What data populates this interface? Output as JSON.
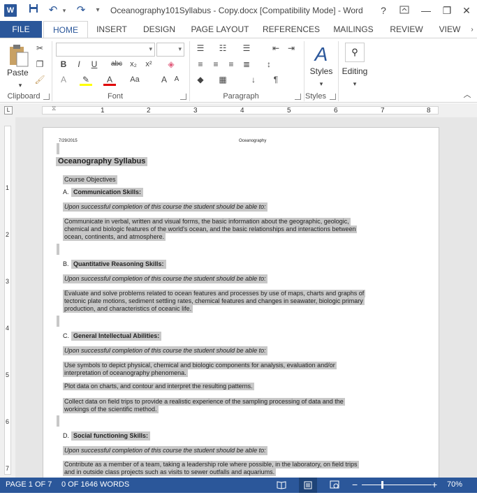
{
  "titlebar": {
    "title": "Oceanography101Syllabus - Copy.docx [Compatibility Mode] - Word",
    "app_logo": "W",
    "help": "?",
    "minimize": "—",
    "restore": "❐",
    "close": "✕"
  },
  "tabs": {
    "file": "FILE",
    "items": [
      "HOME",
      "INSERT",
      "DESIGN",
      "PAGE LAYOUT",
      "REFERENCES",
      "MAILINGS",
      "REVIEW",
      "VIEW"
    ]
  },
  "ribbon": {
    "clipboard": {
      "label": "Clipboard",
      "paste": "Paste"
    },
    "font": {
      "label": "Font",
      "name": "",
      "size": ""
    },
    "paragraph": {
      "label": "Paragraph"
    },
    "styles": {
      "label": "Styles",
      "button": "Styles"
    },
    "editing": {
      "button": "Editing"
    }
  },
  "ruler": {
    "numbers": [
      "1",
      "2",
      "3",
      "4",
      "5",
      "6",
      "7",
      "8"
    ]
  },
  "vruler": {
    "numbers": [
      "1",
      "2",
      "3",
      "4",
      "5",
      "6",
      "7"
    ]
  },
  "document": {
    "header_date": "7/29/2015",
    "header_title": "Oceanography",
    "title": "Oceanography Syllabus",
    "course_objectives": "Course Objectives",
    "sections": [
      {
        "letter": "A.",
        "heading": "Communication   Skills:",
        "intro": "Upon successful completion of this course the student should be able to:",
        "paras": [
          [
            "Communicate in verbal, written and visual forms, the basic information about the geographic, geologic,",
            "chemical and biologic features of the world's ocean, and the basic relationships and interactions between",
            "ocean, continents, and  atmosphere."
          ]
        ]
      },
      {
        "letter": "B.",
        "heading": "Quantitative  Reasoning Skills:",
        "intro": "Upon successful completion of this course the student should be able to:",
        "paras": [
          [
            "Evaluate and solve problems related to ocean features and processes by use of maps, charts and graphs of",
            "tectonic plate motions, sediment settling rates, chemical features and changes in seawater, biologic primary",
            "production, and characteristics  of  oceanic  life."
          ]
        ]
      },
      {
        "letter": "C.",
        "heading": "General  Intellectual Abilities:",
        "intro": "Upon successful completion of this course the student should be able to:",
        "paras": [
          [
            "Use symbols to depict physical, chemical and biologic components for analysis, evaluation and/or",
            "interpretation  of  oceanography phenomena."
          ],
          [
            "Plot data on charts, and contour and interpret the resulting patterns."
          ],
          [
            "Collect data on field trips to provide a realistic experience of the sampling processing of data and the",
            "workings  of  the  scientific method."
          ]
        ]
      },
      {
        "letter": "D.",
        "heading": "Social functioning Skills:",
        "intro": "Upon successful completion of this course the student should be able to:",
        "paras": [
          [
            "Contribute as a member of a team, taking a leadership role where possible, in the laboratory, on field trips",
            "and in outside class projects such as visits to sewer outfalls and    aquariums."
          ]
        ]
      }
    ]
  },
  "statusbar": {
    "page": "PAGE 1 OF 7",
    "words": "0 OF 1646 WORDS",
    "zoom": "70%",
    "zoom_level": 0.7
  },
  "colors": {
    "brand": "#2b579a",
    "selection": "#c8c8c8"
  }
}
